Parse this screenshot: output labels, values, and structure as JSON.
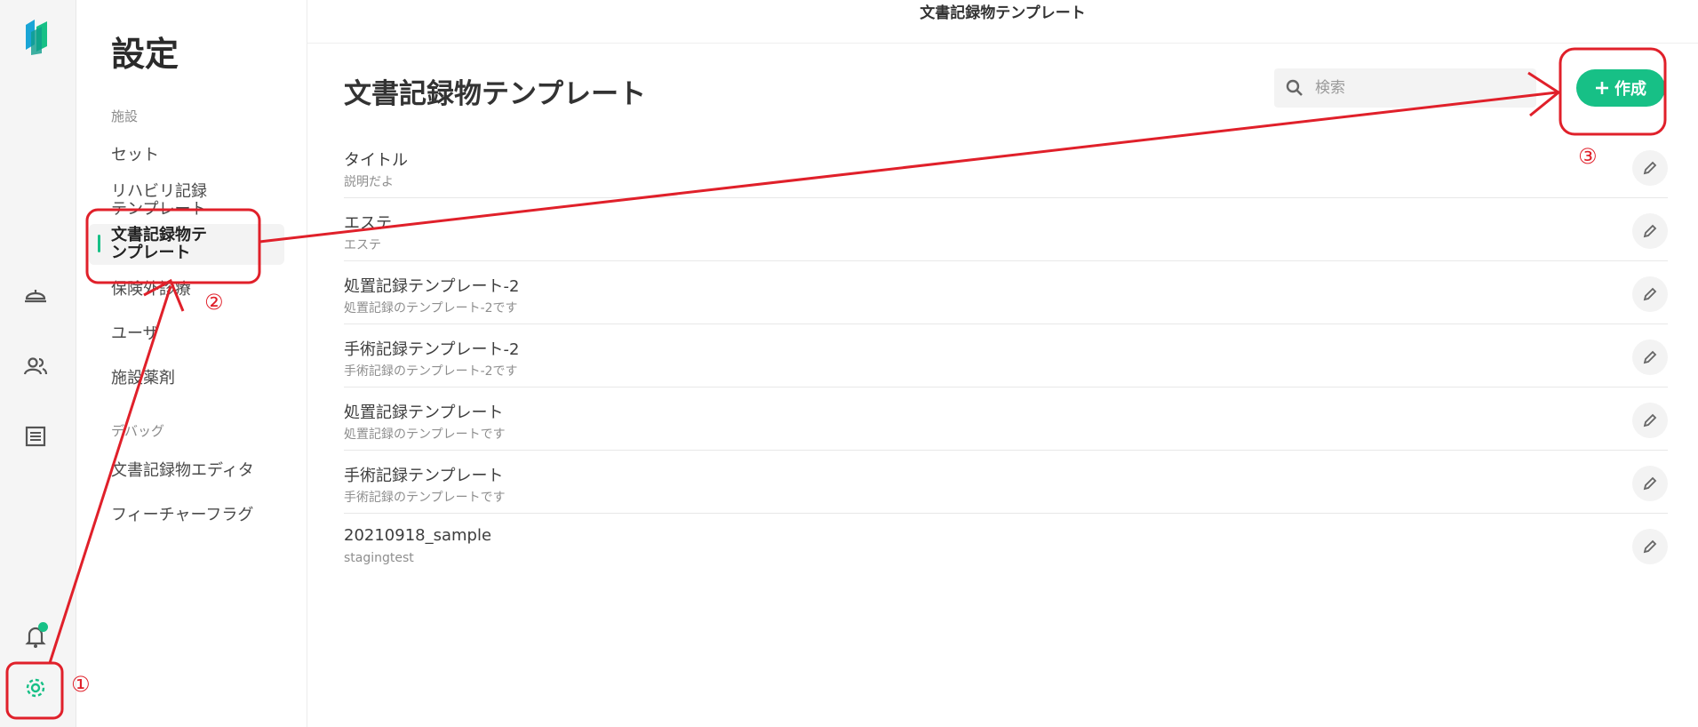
{
  "window_title": "文書記録物テンプレート",
  "rail": {
    "icons": [
      "app-logo",
      "tray-icon",
      "users-icon",
      "list-icon",
      "bell-icon",
      "gear-icon"
    ],
    "accent_color": "#17c086"
  },
  "sidebar": {
    "title": "設定",
    "section_facility": "施設",
    "items": [
      {
        "label": "セット"
      },
      {
        "label": "リハビリ記録テンプレート"
      },
      {
        "label": "文書記録物テンプレート",
        "active": true
      },
      {
        "label": "保険外診療"
      },
      {
        "label": "ユーザ"
      },
      {
        "label": "施設薬剤"
      }
    ],
    "section_debug": "デバッグ",
    "debug_items": [
      {
        "label": "文書記録物エディタ"
      },
      {
        "label": "フィーチャーフラグ"
      }
    ]
  },
  "main": {
    "title": "文書記録物テンプレート",
    "search_placeholder": "検索",
    "create_label": "作成",
    "templates": [
      {
        "title": "タイトル",
        "description": "説明だよ"
      },
      {
        "title": "エステ",
        "description": "エステ"
      },
      {
        "title": "処置記録テンプレート-2",
        "description": "処置記録のテンプレート-2です"
      },
      {
        "title": "手術記録テンプレート-2",
        "description": "手術記録のテンプレート-2です"
      },
      {
        "title": "処置記録テンプレート",
        "description": "処置記録のテンプレートです"
      },
      {
        "title": "手術記録テンプレート",
        "description": "手術記録のテンプレートです"
      },
      {
        "title": "20210918_sample",
        "description": "stagingtest"
      }
    ]
  },
  "annotations": {
    "step1": "①",
    "step2": "②",
    "step3": "③",
    "color": "#e0202a"
  }
}
